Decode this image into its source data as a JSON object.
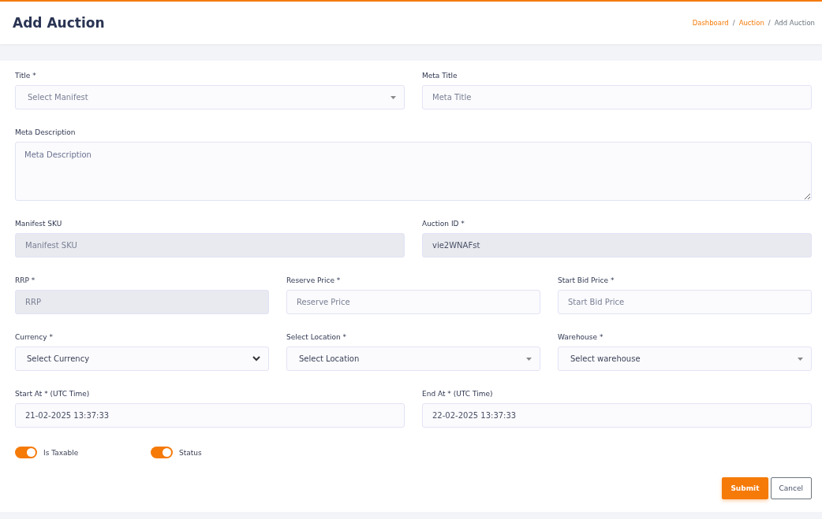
{
  "page": {
    "title": "Add Auction"
  },
  "breadcrumb_separator": "/",
  "breadcrumb": [
    {
      "label": "Dashboard",
      "current": false
    },
    {
      "label": "Auction",
      "current": false
    },
    {
      "label": "Add Auction",
      "current": true
    }
  ],
  "form_rows": [
    [
      {
        "label": "Title *",
        "kind": "select",
        "placeholder": "Select Manifest"
      },
      {
        "label": "Meta Title",
        "kind": "text",
        "placeholder": "Meta Title",
        "disabled": false
      }
    ],
    [
      {
        "label": "Meta Description",
        "kind": "textarea",
        "placeholder": "Meta Description"
      }
    ],
    [
      {
        "label": "Manifest SKU",
        "kind": "text",
        "placeholder": "Manifest SKU",
        "disabled": true
      },
      {
        "label": "Auction ID *",
        "kind": "text",
        "value": "vie2WNAFst",
        "disabled": true
      }
    ],
    [
      {
        "label": "RRP *",
        "kind": "text",
        "placeholder": "RRP",
        "disabled": true
      },
      {
        "label": "Reserve Price *",
        "kind": "text",
        "placeholder": "Reserve Price",
        "disabled": false
      },
      {
        "label": "Start Bid Price *",
        "kind": "text",
        "placeholder": "Start Bid Price",
        "disabled": false
      }
    ],
    [
      {
        "label": "Currency *",
        "kind": "native-select",
        "value": "Select Currency"
      },
      {
        "label": "Select Location *",
        "kind": "select",
        "value": "Select Location"
      },
      {
        "label": "Warehouse *",
        "kind": "select",
        "value": "Select warehouse"
      }
    ],
    [
      {
        "label": "Start At * (UTC Time)",
        "kind": "text",
        "value": "21-02-2025 13:37:33",
        "disabled": false
      },
      {
        "label": "End At * (UTC Time)",
        "kind": "text",
        "value": "22-02-2025 13:37:33",
        "disabled": false
      }
    ]
  ],
  "toggles": [
    {
      "label": "Is Taxable",
      "on": true
    },
    {
      "label": "Status",
      "on": true
    }
  ],
  "buttons": [
    {
      "label": "Submit",
      "kind": "primary"
    },
    {
      "label": "Cancel",
      "kind": "secondary"
    }
  ]
}
